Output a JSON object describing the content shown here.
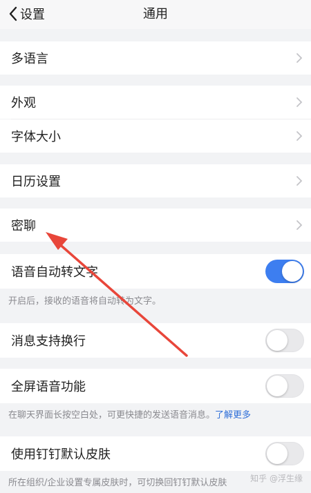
{
  "nav": {
    "back_label": "设置",
    "title": "通用"
  },
  "rows": {
    "multi_language": "多语言",
    "appearance": "外观",
    "font_size": "字体大小",
    "calendar_settings": "日历设置",
    "secret_chat": "密聊",
    "voice_to_text": "语音自动转文字",
    "message_line_break": "消息支持换行",
    "fullscreen_voice": "全屏语音功能",
    "default_skin": "使用钉钉默认皮肤"
  },
  "toggles": {
    "voice_to_text": true,
    "message_line_break": false,
    "fullscreen_voice": false,
    "default_skin": false
  },
  "hints": {
    "voice_to_text": "开启后，接收的语音将自动转为文字。",
    "fullscreen_voice": "在聊天界面长按空白处，可更快捷的发送语音消息。",
    "fullscreen_voice_link": "了解更多",
    "default_skin": "所在组织/企业设置专属皮肤时，可切换回钉钉默认皮肤"
  },
  "watermark": "知乎 @浮生缘",
  "colors": {
    "toggle_on": "#3d7ef0",
    "link": "#2f6fd8",
    "annotation_arrow": "#e8463a"
  },
  "icons": [
    "chevron-left-icon",
    "chevron-right-icon"
  ]
}
